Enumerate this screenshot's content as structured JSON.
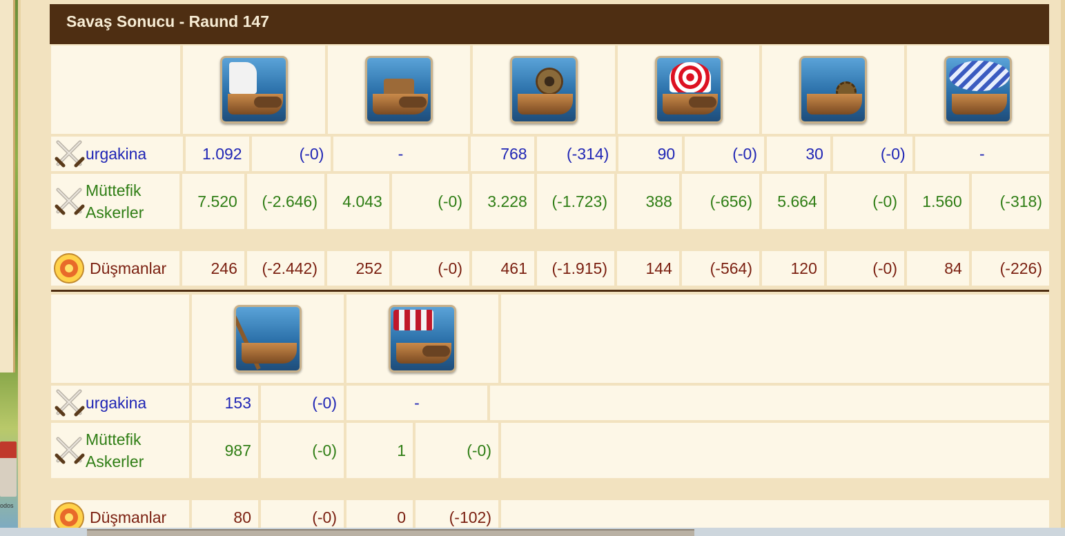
{
  "window": {
    "title": "Savaş Sonucu - Raund 147"
  },
  "game": {
    "tiny_label": "odos"
  },
  "labels": {
    "player": "urgakina",
    "allies_line1": "Müttefik",
    "allies_line2": "Askerler",
    "enemies": "Düşmanlar"
  },
  "colors": {
    "player": "#1f25b5",
    "allies": "#2e7d14",
    "enemies": "#7a1f10",
    "title_bar": "#4e2e12"
  },
  "sections": [
    {
      "units": [
        {
          "icon": "sail-ship-icon",
          "player": "1.092",
          "player_loss": "(-0)",
          "allies": "7.520",
          "allies_loss": "(-2.646)",
          "enemies": "246",
          "enemies_loss": "(-2.442)"
        },
        {
          "icon": "mortar-ship-icon",
          "player": "-",
          "player_loss": "",
          "allies": "4.043",
          "allies_loss": "(-0)",
          "enemies": "252",
          "enemies_loss": "(-0)"
        },
        {
          "icon": "paddle-ship-icon",
          "player": "768",
          "player_loss": "(-314)",
          "allies": "3.228",
          "allies_loss": "(-1.723)",
          "enemies": "461",
          "enemies_loss": "(-1.915)"
        },
        {
          "icon": "ballista-ship-icon",
          "player": "90",
          "player_loss": "(-0)",
          "allies": "388",
          "allies_loss": "(-656)",
          "enemies": "144",
          "enemies_loss": "(-564)"
        },
        {
          "icon": "steam-ram-icon",
          "player": "30",
          "player_loss": "(-0)",
          "allies": "5.664",
          "allies_loss": "(-0)",
          "enemies": "120",
          "enemies_loss": "(-0)"
        },
        {
          "icon": "balloon-carrier-icon",
          "player": "-",
          "player_loss": "",
          "allies": "1.560",
          "allies_loss": "(-318)",
          "enemies": "84",
          "enemies_loss": "(-226)"
        }
      ]
    },
    {
      "units": [
        {
          "icon": "crane-ship-icon",
          "player": "153",
          "player_loss": "(-0)",
          "allies": "987",
          "allies_loss": "(-0)",
          "enemies": "80",
          "enemies_loss": "(-0)"
        },
        {
          "icon": "tender-ship-icon",
          "player": "-",
          "player_loss": "",
          "allies": "1",
          "allies_loss": "(-0)",
          "enemies": "0",
          "enemies_loss": "(-102)"
        }
      ]
    }
  ]
}
